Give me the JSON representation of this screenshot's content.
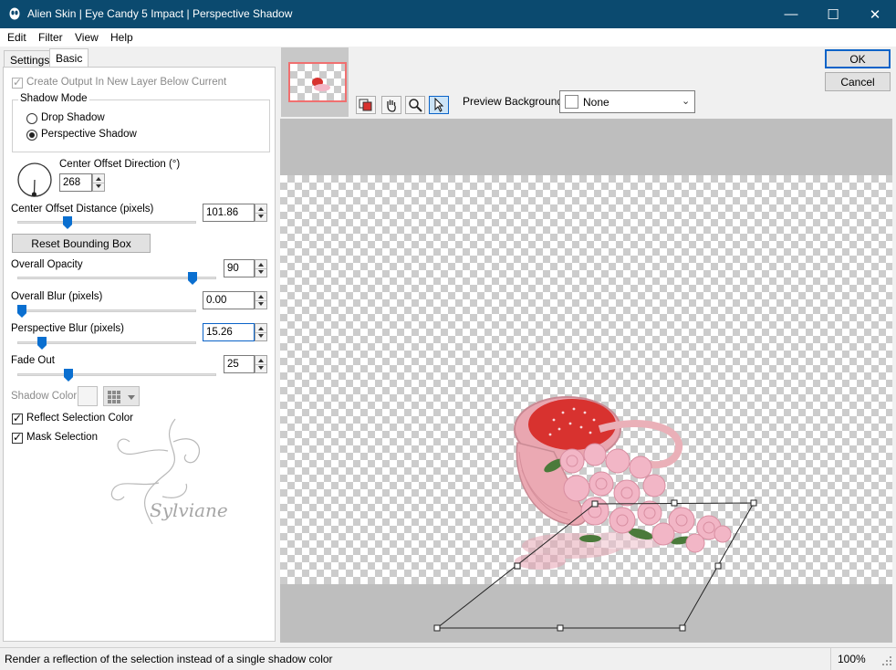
{
  "window": {
    "title": "Alien Skin | Eye Candy 5 Impact | Perspective Shadow",
    "minimize_glyph": "—",
    "maximize_glyph": "☐",
    "close_glyph": "✕"
  },
  "menu": [
    "Edit",
    "Filter",
    "View",
    "Help"
  ],
  "tabs": [
    "Settings",
    "Basic"
  ],
  "panel": {
    "create_output_label": "Create Output In New Layer Below Current",
    "shadow_mode_label": "Shadow Mode",
    "drop_shadow_label": "Drop Shadow",
    "perspective_shadow_label": "Perspective Shadow",
    "center_offset_direction_label": "Center Offset Direction (°)",
    "center_offset_direction_value": "268",
    "center_offset_distance_label": "Center Offset Distance (pixels)",
    "center_offset_distance_value": "101.86",
    "reset_bounding_box_label": "Reset Bounding Box",
    "overall_opacity_label": "Overall Opacity",
    "overall_opacity_value": "90",
    "overall_blur_label": "Overall Blur (pixels)",
    "overall_blur_value": "0.00",
    "perspective_blur_label": "Perspective Blur (pixels)",
    "perspective_blur_value": "15.26",
    "fade_out_label": "Fade Out",
    "fade_out_value": "25",
    "shadow_color_label": "Shadow Color",
    "reflect_selection_label": "Reflect Selection Color",
    "mask_selection_label": "Mask Selection"
  },
  "watermark": {
    "text": "Sylviane"
  },
  "preview": {
    "background_label": "Preview Background:",
    "background_value": "None"
  },
  "dialog": {
    "ok_label": "OK",
    "cancel_label": "Cancel"
  },
  "status": {
    "message": "Render a reflection of the selection instead of a single shadow color",
    "zoom": "100%"
  },
  "colors": {
    "titlebar": "#0b4a6f",
    "accent": "#0a6fd0",
    "preview_bg": "#bebebe",
    "basket_red": "#d8322f",
    "rose_pink": "#f2b6c6"
  }
}
